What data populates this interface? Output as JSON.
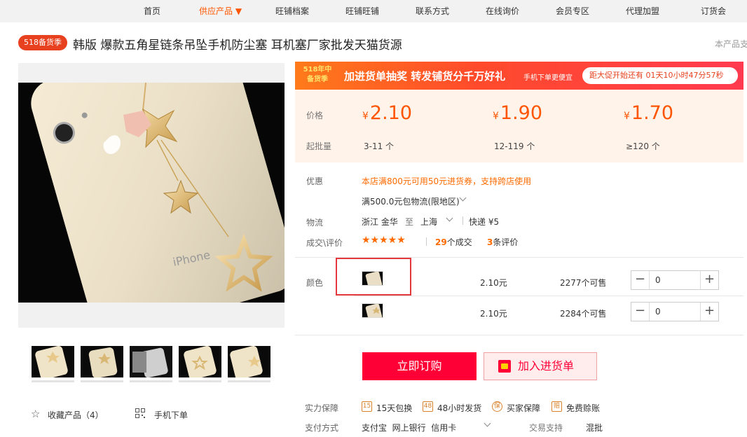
{
  "nav": {
    "items": [
      "首页",
      "供应产品",
      "旺铺档案",
      "旺铺旺铺",
      "联系方式",
      "在线询价",
      "会员专区",
      "代理加盟",
      "订货会"
    ],
    "active_arrow": "▼"
  },
  "title": {
    "badge": "518备货季",
    "text": "韩版 爆款五角星链条吊坠手机防尘塞 耳机塞厂家批发天猫货源",
    "right_hint": "本产品支"
  },
  "promo": {
    "badge_line1": "518年中",
    "badge_line2": "备货季",
    "headline": "加进货单抽奖 转发铺货分千万好礼",
    "sub": "手机下单更便宜",
    "countdown": "距大促开始还有 01天10小时47分57秒"
  },
  "price": {
    "price_label": "价格",
    "qty_label": "起批量",
    "currency": "¥",
    "tiers": [
      {
        "price": "2.10",
        "qty": "3-11 个"
      },
      {
        "price": "1.90",
        "qty": "12-119 个"
      },
      {
        "price": "1.70",
        "qty": "≥120 个"
      }
    ]
  },
  "info": {
    "discount_label": "优惠",
    "discount_text": "本店满800元可用50元进货券，支持跨店使用",
    "shipping_offer": "满500.0元包物流(限地区)",
    "logistics_label": "物流",
    "from": "浙江 金华",
    "to_word": "至",
    "to": "上海",
    "express": "快递 ¥5",
    "deals_label": "成交\\评价",
    "stars": "★★★★★",
    "deals_count": "29",
    "deals_suffix": "个成交",
    "review_count": "3",
    "review_suffix": "条评价"
  },
  "sku": {
    "color_label": "颜色",
    "rows": [
      {
        "price": "2.10元",
        "stock": "2277个可售",
        "qty": "0"
      },
      {
        "price": "2.10元",
        "stock": "2284个可售",
        "qty": "0"
      }
    ]
  },
  "actions": {
    "buy": "立即订购",
    "cart": "加入进货单",
    "favorite": "收藏产品（4）",
    "mobile": "手机下单"
  },
  "guarantee": {
    "label": "实力保障",
    "items": [
      {
        "icon": "15",
        "text": "15天包换"
      },
      {
        "icon": "48",
        "text": "48小时发货"
      },
      {
        "icon": "保",
        "text": "买家保障"
      },
      {
        "icon": "赔",
        "text": "免费赊账"
      }
    ]
  },
  "payment": {
    "label": "支付方式",
    "methods": "支付宝  网上银行  信用卡",
    "trade_label": "交易支持",
    "trade_value": "混批"
  }
}
